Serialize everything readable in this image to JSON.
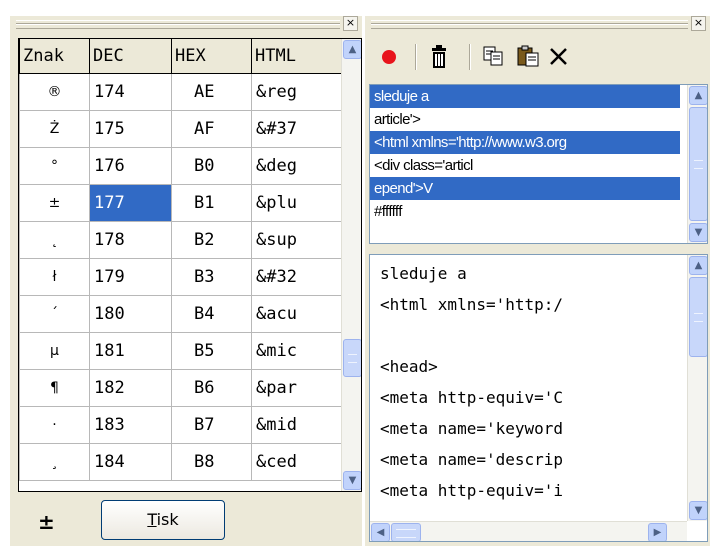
{
  "left_panel": {
    "close_glyph": "×",
    "columns": [
      "Znak",
      "DEC",
      "HEX",
      "HTML"
    ],
    "rows": [
      {
        "znak": "®",
        "dec": "174",
        "hex": "AE",
        "html": "&reg"
      },
      {
        "znak": "Ż",
        "dec": "175",
        "hex": "AF",
        "html": "&#37"
      },
      {
        "znak": "°",
        "dec": "176",
        "hex": "B0",
        "html": "&deg"
      },
      {
        "znak": "±",
        "dec": "177",
        "hex": "B1",
        "html": "&plu"
      },
      {
        "znak": "˛",
        "dec": "178",
        "hex": "B2",
        "html": "&sup"
      },
      {
        "znak": "ł",
        "dec": "179",
        "hex": "B3",
        "html": "&#32"
      },
      {
        "znak": "´",
        "dec": "180",
        "hex": "B4",
        "html": "&acu"
      },
      {
        "znak": "µ",
        "dec": "181",
        "hex": "B5",
        "html": "&mic"
      },
      {
        "znak": "¶",
        "dec": "182",
        "hex": "B6",
        "html": "&par"
      },
      {
        "znak": "·",
        "dec": "183",
        "hex": "B7",
        "html": "&mid"
      },
      {
        "znak": "¸",
        "dec": "184",
        "hex": "B8",
        "html": "&ced"
      }
    ],
    "selected_cell": "177",
    "selected_symbol": "±",
    "print_button": "Tisk",
    "print_accesskey": "T"
  },
  "right_panel": {
    "close_glyph": "×",
    "toolbar": {
      "record_icon": "record-icon",
      "delete_icon": "trash-icon",
      "copy_icon": "copy-icon",
      "paste_icon": "paste-icon",
      "clear_icon": "close-icon"
    },
    "history_items": [
      {
        "text": "sleduje a",
        "selected": true
      },
      {
        "text": "article'>",
        "selected": false
      },
      {
        "text": "<html xmlns='http://www.w3.org",
        "selected": true
      },
      {
        "text": "<div class='articl",
        "selected": false
      },
      {
        "text": "epend'>V",
        "selected": true
      },
      {
        "text": "#ffffff",
        "selected": false
      }
    ],
    "editor_lines": [
      "sleduje a",
      "<html xmlns='http:/",
      "",
      "<head>",
      "<meta http-equiv='C",
      "<meta name='keyword",
      "<meta name='descrip",
      "<meta http-equiv='i"
    ]
  },
  "colors": {
    "selection": "#316ac5",
    "window_bg": "#ece9d8",
    "record": "#e8141c"
  }
}
